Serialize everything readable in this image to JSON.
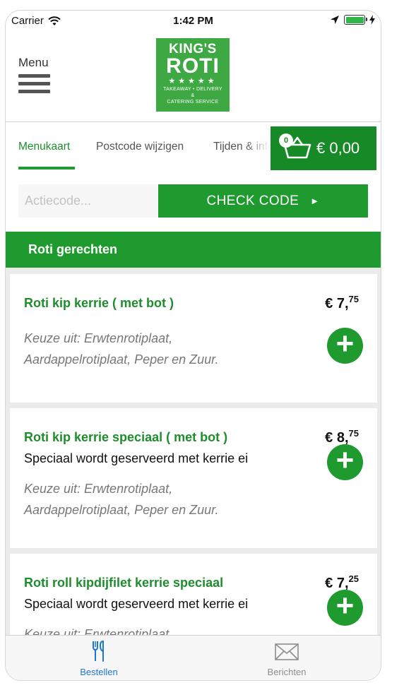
{
  "status_bar": {
    "carrier": "Carrier",
    "time": "1:42 PM"
  },
  "header": {
    "menu_label": "Menu",
    "logo": {
      "line1": "KING'S",
      "line2": "ROTI",
      "stars": "★★★★★",
      "tag1": "TAKEAWAY • DELIVERY",
      "tag2": "&",
      "tag3": "CATERING SERVICE"
    }
  },
  "tabs": [
    {
      "label": "Menukaart",
      "active": true
    },
    {
      "label": "Postcode wijzigen",
      "active": false
    },
    {
      "label": "Tijden & info",
      "active": false
    }
  ],
  "cart": {
    "count": "0",
    "total": "€ 0,00"
  },
  "action_code": {
    "placeholder": "Actiecode...",
    "button_label": "CHECK CODE"
  },
  "category": "Roti gerechten",
  "items": [
    {
      "name": "Roti kip kerrie ( met bot )",
      "subtitle": "",
      "price_main": "€ 7,",
      "price_cents": "75",
      "description": [
        "Keuze uit: Erwtenrotiplaat,",
        "Aardappelrotiplaat, Peper en Zuur."
      ]
    },
    {
      "name": "Roti kip kerrie speciaal ( met bot )",
      "subtitle": "Speciaal wordt geserveerd met kerrie ei",
      "price_main": "€ 8,",
      "price_cents": "75",
      "description": [
        "Keuze uit: Erwtenrotiplaat,",
        "Aardappelrotiplaat, Peper en Zuur."
      ]
    },
    {
      "name": "Roti roll kipdijfilet kerrie speciaal",
      "subtitle": "Speciaal wordt geserveerd met kerrie ei",
      "price_main": "€ 7,",
      "price_cents": "25",
      "description": [
        "Keuze uit: Erwtenrotiplaat,"
      ]
    }
  ],
  "tab_bar": [
    {
      "label": "Bestellen",
      "icon": "fork-knife-icon",
      "active": true
    },
    {
      "label": "Berichten",
      "icon": "envelope-icon",
      "active": false
    }
  ],
  "colors": {
    "brand_green": "#1f9a2f",
    "dark_green": "#168a26",
    "active_blue": "#1e76d3"
  }
}
